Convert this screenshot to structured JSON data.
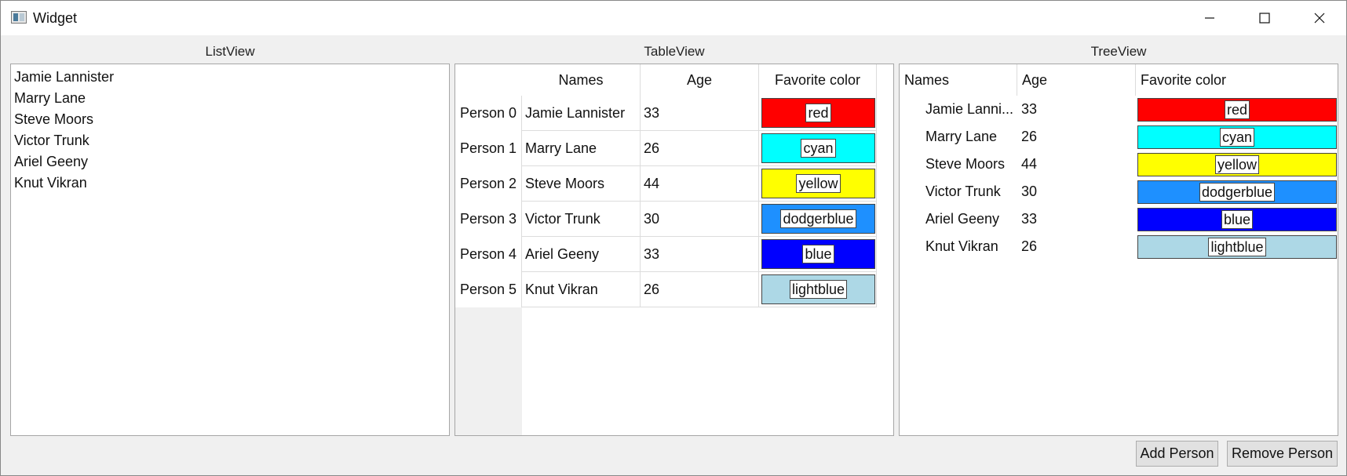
{
  "window": {
    "title": "Widget"
  },
  "sections": {
    "list_label": "ListView",
    "table_label": "TableView",
    "tree_label": "TreeView"
  },
  "list_view": {
    "items": [
      "Jamie Lannister",
      "Marry Lane",
      "Steve Moors",
      "Victor Trunk",
      "Ariel Geeny",
      "Knut Vikran"
    ]
  },
  "table_view": {
    "headers": [
      "Names",
      "Age",
      "Favorite color"
    ],
    "row_headers": [
      "Person 0",
      "Person 1",
      "Person 2",
      "Person 3",
      "Person 4",
      "Person 5"
    ],
    "rows": [
      {
        "name": "Jamie Lannister",
        "age": "33",
        "color": "red",
        "hex": "#ff0000"
      },
      {
        "name": "Marry Lane",
        "age": "26",
        "color": "cyan",
        "hex": "#00ffff"
      },
      {
        "name": "Steve Moors",
        "age": "44",
        "color": "yellow",
        "hex": "#ffff00"
      },
      {
        "name": "Victor Trunk",
        "age": "30",
        "color": "dodgerblue",
        "hex": "#1e90ff"
      },
      {
        "name": "Ariel Geeny",
        "age": "33",
        "color": "blue",
        "hex": "#0000ff"
      },
      {
        "name": "Knut Vikran",
        "age": "26",
        "color": "lightblue",
        "hex": "#add8e6"
      }
    ]
  },
  "tree_view": {
    "headers": [
      "Names",
      "Age",
      "Favorite color"
    ],
    "rows": [
      {
        "name": "Jamie Lanni...",
        "age": "33",
        "color": "red",
        "hex": "#ff0000"
      },
      {
        "name": "Marry Lane",
        "age": "26",
        "color": "cyan",
        "hex": "#00ffff"
      },
      {
        "name": "Steve Moors",
        "age": "44",
        "color": "yellow",
        "hex": "#ffff00"
      },
      {
        "name": "Victor Trunk",
        "age": "30",
        "color": "dodgerblue",
        "hex": "#1e90ff"
      },
      {
        "name": "Ariel Geeny",
        "age": "33",
        "color": "blue",
        "hex": "#0000ff"
      },
      {
        "name": "Knut Vikran",
        "age": "26",
        "color": "lightblue",
        "hex": "#add8e6"
      }
    ]
  },
  "buttons": {
    "add_person": "Add Person",
    "remove_person": "Remove Person"
  },
  "icons": {
    "app": "app-window-icon",
    "minimize": "minimize-icon",
    "maximize": "maximize-icon",
    "close": "close-icon"
  }
}
